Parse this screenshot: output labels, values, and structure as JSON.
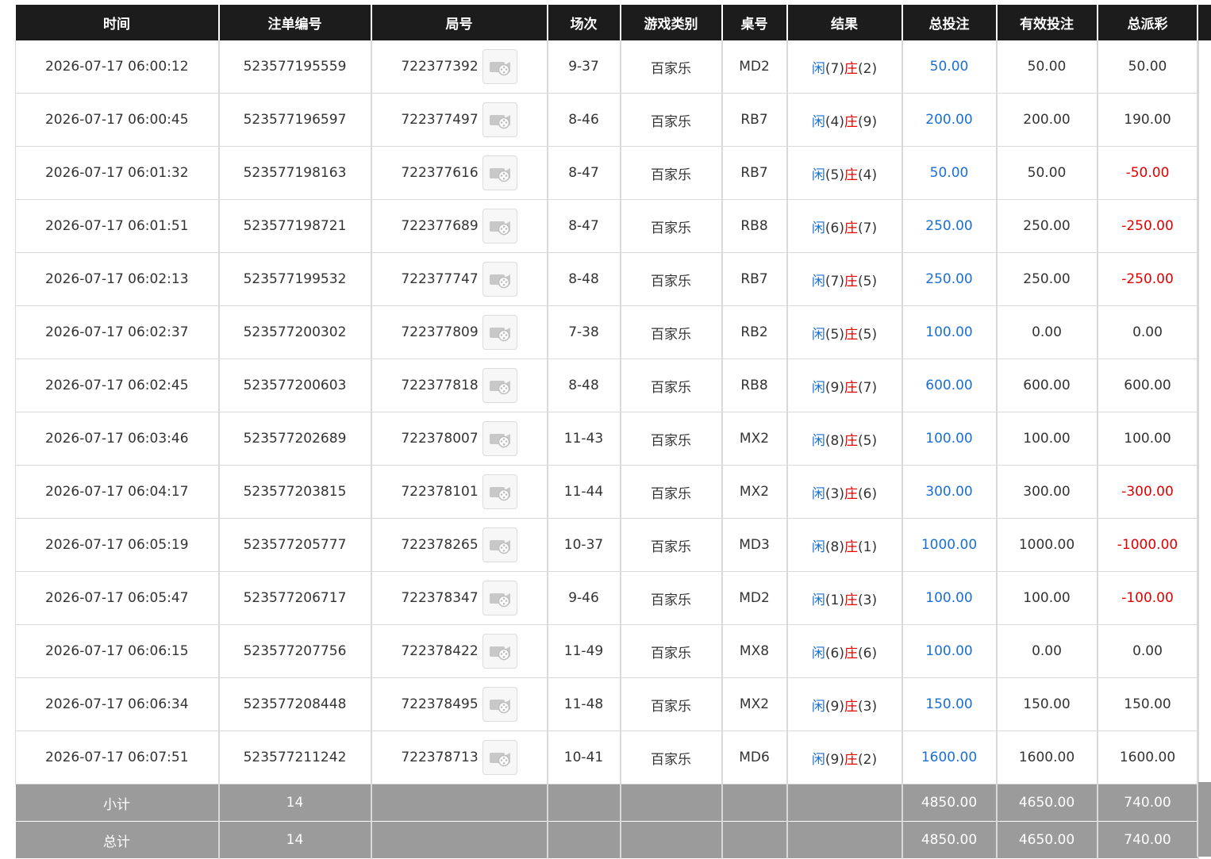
{
  "columns": [
    "时间",
    "注单编号",
    "局号",
    "场次",
    "游戏类别",
    "桌号",
    "结果",
    "总投注",
    "有效投注",
    "总派彩"
  ],
  "colors": {
    "header_bg": "#1c1c1c",
    "footer_bg": "#9b9b9b",
    "blue": "#1a6fd6",
    "red": "#e00000"
  },
  "player_label": "闲",
  "banker_label": "庄",
  "replay_icon": "video-replay-icon",
  "rows": [
    {
      "time": "2026-07-17 06:00:12",
      "bet_id": "523577195559",
      "round": "722377392",
      "shoe": "9-37",
      "game": "百家乐",
      "table": "MD2",
      "player": "(7)",
      "banker": "(2)",
      "total_bet": "50.00",
      "valid_bet": "50.00",
      "payout": "50.00",
      "payout_negative": false
    },
    {
      "time": "2026-07-17 06:00:45",
      "bet_id": "523577196597",
      "round": "722377497",
      "shoe": "8-46",
      "game": "百家乐",
      "table": "RB7",
      "player": "(4)",
      "banker": "(9)",
      "total_bet": "200.00",
      "valid_bet": "200.00",
      "payout": "190.00",
      "payout_negative": false
    },
    {
      "time": "2026-07-17 06:01:32",
      "bet_id": "523577198163",
      "round": "722377616",
      "shoe": "8-47",
      "game": "百家乐",
      "table": "RB7",
      "player": "(5)",
      "banker": "(4)",
      "total_bet": "50.00",
      "valid_bet": "50.00",
      "payout": "-50.00",
      "payout_negative": true
    },
    {
      "time": "2026-07-17 06:01:51",
      "bet_id": "523577198721",
      "round": "722377689",
      "shoe": "8-47",
      "game": "百家乐",
      "table": "RB8",
      "player": "(6)",
      "banker": "(7)",
      "total_bet": "250.00",
      "valid_bet": "250.00",
      "payout": "-250.00",
      "payout_negative": true
    },
    {
      "time": "2026-07-17 06:02:13",
      "bet_id": "523577199532",
      "round": "722377747",
      "shoe": "8-48",
      "game": "百家乐",
      "table": "RB7",
      "player": "(7)",
      "banker": "(5)",
      "total_bet": "250.00",
      "valid_bet": "250.00",
      "payout": "-250.00",
      "payout_negative": true
    },
    {
      "time": "2026-07-17 06:02:37",
      "bet_id": "523577200302",
      "round": "722377809",
      "shoe": "7-38",
      "game": "百家乐",
      "table": "RB2",
      "player": "(5)",
      "banker": "(5)",
      "total_bet": "100.00",
      "valid_bet": "0.00",
      "payout": "0.00",
      "payout_negative": false
    },
    {
      "time": "2026-07-17 06:02:45",
      "bet_id": "523577200603",
      "round": "722377818",
      "shoe": "8-48",
      "game": "百家乐",
      "table": "RB8",
      "player": "(9)",
      "banker": "(7)",
      "total_bet": "600.00",
      "valid_bet": "600.00",
      "payout": "600.00",
      "payout_negative": false
    },
    {
      "time": "2026-07-17 06:03:46",
      "bet_id": "523577202689",
      "round": "722378007",
      "shoe": "11-43",
      "game": "百家乐",
      "table": "MX2",
      "player": "(8)",
      "banker": "(5)",
      "total_bet": "100.00",
      "valid_bet": "100.00",
      "payout": "100.00",
      "payout_negative": false
    },
    {
      "time": "2026-07-17 06:04:17",
      "bet_id": "523577203815",
      "round": "722378101",
      "shoe": "11-44",
      "game": "百家乐",
      "table": "MX2",
      "player": "(3)",
      "banker": "(6)",
      "total_bet": "300.00",
      "valid_bet": "300.00",
      "payout": "-300.00",
      "payout_negative": true
    },
    {
      "time": "2026-07-17 06:05:19",
      "bet_id": "523577205777",
      "round": "722378265",
      "shoe": "10-37",
      "game": "百家乐",
      "table": "MD3",
      "player": "(8)",
      "banker": "(1)",
      "total_bet": "1000.00",
      "valid_bet": "1000.00",
      "payout": "-1000.00",
      "payout_negative": true
    },
    {
      "time": "2026-07-17 06:05:47",
      "bet_id": "523577206717",
      "round": "722378347",
      "shoe": "9-46",
      "game": "百家乐",
      "table": "MD2",
      "player": "(1)",
      "banker": "(3)",
      "total_bet": "100.00",
      "valid_bet": "100.00",
      "payout": "-100.00",
      "payout_negative": true
    },
    {
      "time": "2026-07-17 06:06:15",
      "bet_id": "523577207756",
      "round": "722378422",
      "shoe": "11-49",
      "game": "百家乐",
      "table": "MX8",
      "player": "(6)",
      "banker": "(6)",
      "total_bet": "100.00",
      "valid_bet": "0.00",
      "payout": "0.00",
      "payout_negative": false
    },
    {
      "time": "2026-07-17 06:06:34",
      "bet_id": "523577208448",
      "round": "722378495",
      "shoe": "11-48",
      "game": "百家乐",
      "table": "MX2",
      "player": "(9)",
      "banker": "(3)",
      "total_bet": "150.00",
      "valid_bet": "150.00",
      "payout": "150.00",
      "payout_negative": false
    },
    {
      "time": "2026-07-17 06:07:51",
      "bet_id": "523577211242",
      "round": "722378713",
      "shoe": "10-41",
      "game": "百家乐",
      "table": "MD6",
      "player": "(9)",
      "banker": "(2)",
      "total_bet": "1600.00",
      "valid_bet": "1600.00",
      "payout": "1600.00",
      "payout_negative": false
    }
  ],
  "subtotal": {
    "label": "小计",
    "count": "14",
    "total_bet": "4850.00",
    "valid_bet": "4650.00",
    "payout": "740.00"
  },
  "grandtotal": {
    "label": "总计",
    "count": "14",
    "total_bet": "4850.00",
    "valid_bet": "4650.00",
    "payout": "740.00"
  }
}
